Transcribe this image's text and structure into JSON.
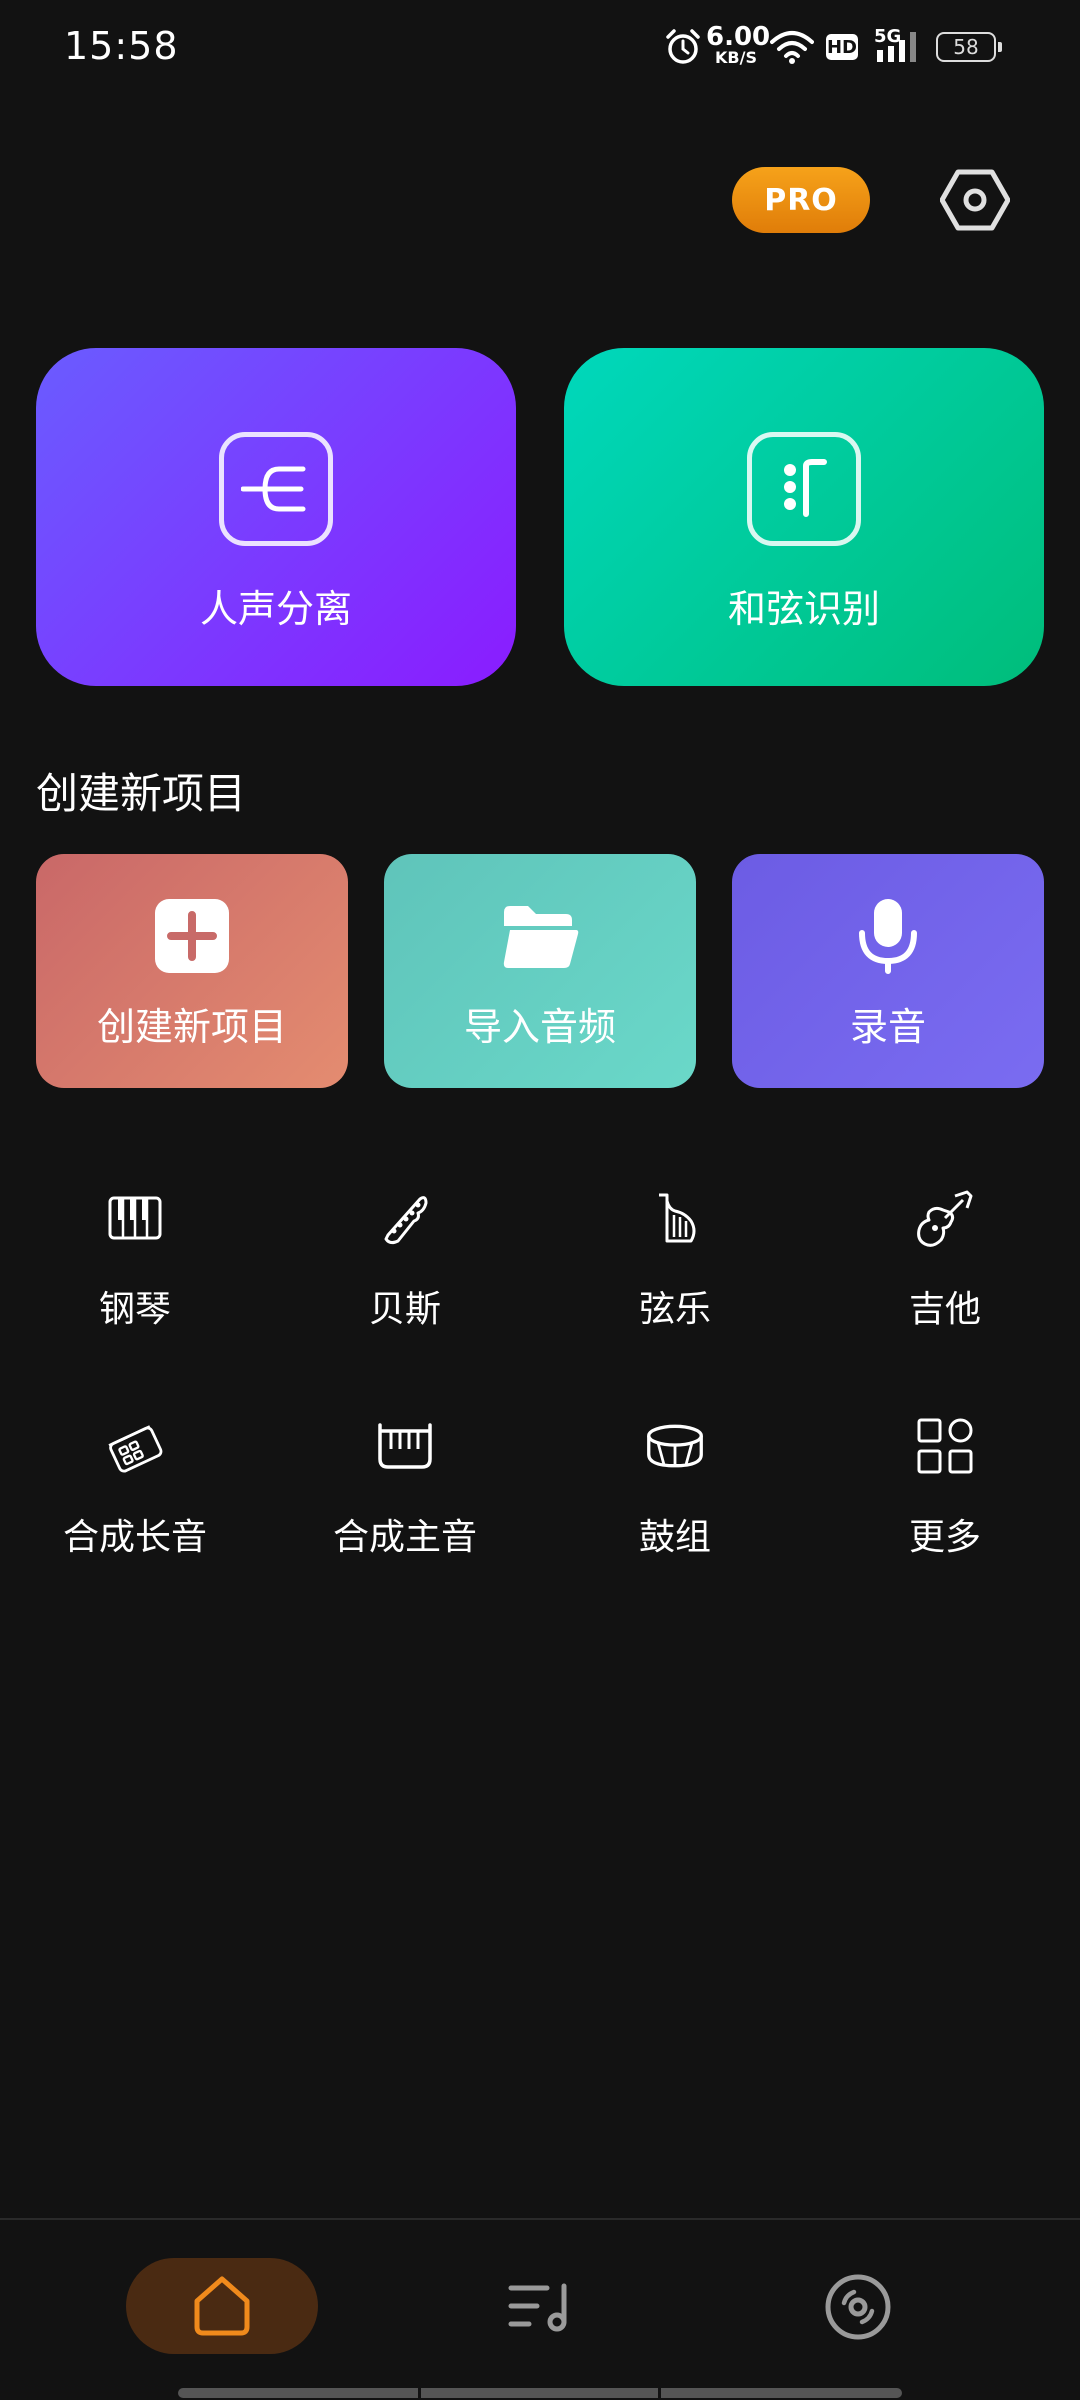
{
  "status_bar": {
    "time": "15:58",
    "net_speed_value": "6.00",
    "net_speed_unit": "KB/S",
    "hd": "HD",
    "network": "5G",
    "battery": "58",
    "icons": [
      "alarm-icon",
      "wifi-icon",
      "signal-icon",
      "battery-icon"
    ]
  },
  "header": {
    "pro_label": "PRO",
    "pro_color": "#f19014",
    "settings_icon": "settings-hexagon-icon"
  },
  "feature_cards": [
    {
      "label": "人声分离",
      "icon": "vocal-split-icon",
      "colors": [
        "#6a5cff",
        "#8a1cff"
      ]
    },
    {
      "label": "和弦识别",
      "icon": "chord-recognition-icon",
      "colors": [
        "#00d8bc",
        "#00bd7a"
      ]
    }
  ],
  "section_title": "创建新项目",
  "action_cards": [
    {
      "label": "创建新项目",
      "icon": "plus-icon",
      "colors": [
        "#c96868",
        "#e48c70"
      ]
    },
    {
      "label": "导入音频",
      "icon": "folder-icon",
      "colors": [
        "#5fc4ba",
        "#6ad8c9"
      ]
    },
    {
      "label": "录音",
      "icon": "microphone-icon",
      "colors": [
        "#6c5ce4",
        "#7a6cf1"
      ]
    }
  ],
  "tools": [
    {
      "label": "钢琴",
      "icon": "piano-icon"
    },
    {
      "label": "贝斯",
      "icon": "bass-icon"
    },
    {
      "label": "弦乐",
      "icon": "harp-icon"
    },
    {
      "label": "吉他",
      "icon": "guitar-icon"
    },
    {
      "label": "合成长音",
      "icon": "synth-pad-icon"
    },
    {
      "label": "合成主音",
      "icon": "synth-lead-icon"
    },
    {
      "label": "鼓组",
      "icon": "drum-icon"
    },
    {
      "label": "更多",
      "icon": "more-grid-icon"
    }
  ],
  "bottom_nav": {
    "active": "home",
    "accent": "#f08a1c",
    "items": [
      "home-icon",
      "playlist-icon",
      "disc-icon"
    ]
  }
}
